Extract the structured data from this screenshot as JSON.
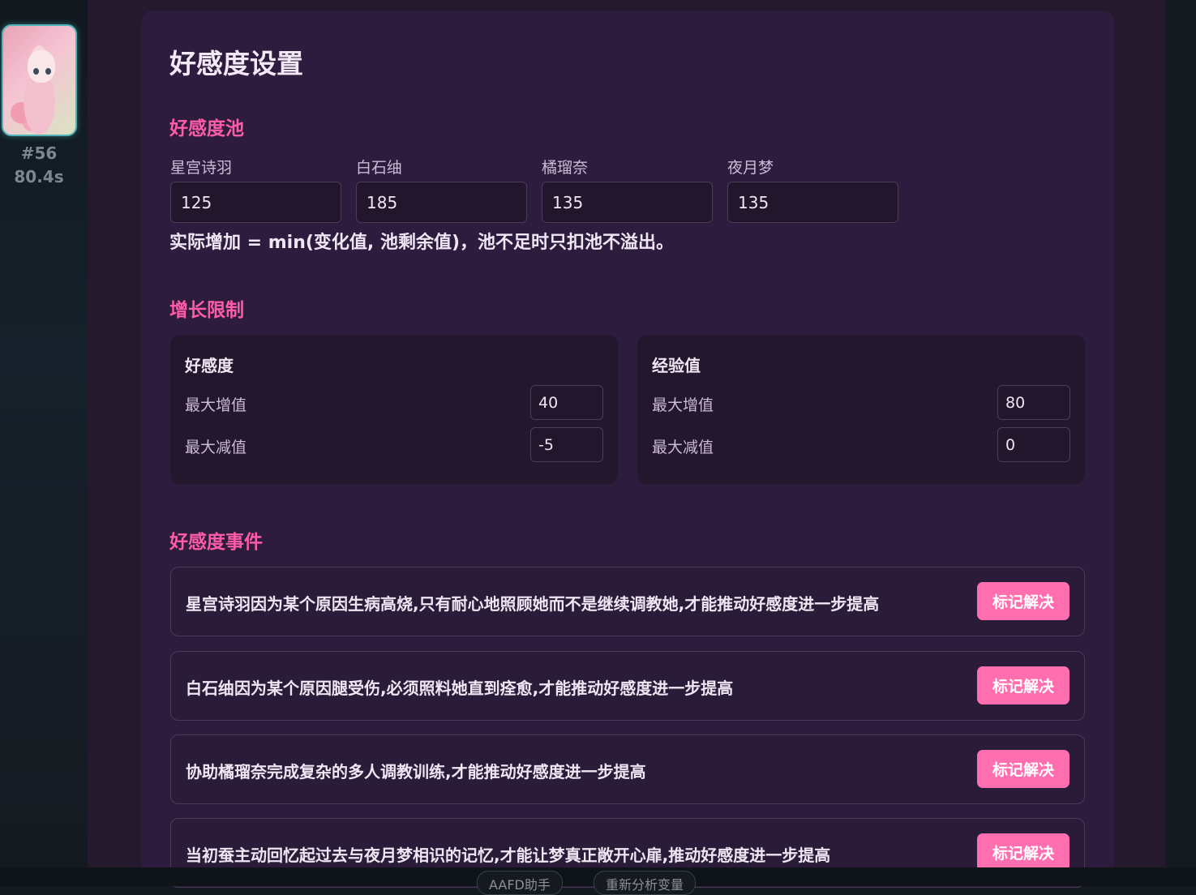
{
  "sidebar": {
    "index": "#56",
    "time": "80.4s"
  },
  "page": {
    "title": "好感度设置"
  },
  "pool": {
    "section_title": "好感度池",
    "characters": [
      {
        "name": "星宫诗羽",
        "value": "125"
      },
      {
        "name": "白石䌷",
        "value": "185"
      },
      {
        "name": "橘瑠奈",
        "value": "135"
      },
      {
        "name": "夜月梦",
        "value": "135"
      }
    ],
    "note": "实际增加 = min(变化值, 池剩余值)，池不足时只扣池不溢出。"
  },
  "limits": {
    "section_title": "增长限制",
    "boxes": [
      {
        "title": "好感度",
        "max_inc_label": "最大增值",
        "max_inc": "40",
        "max_dec_label": "最大减值",
        "max_dec": "-5"
      },
      {
        "title": "经验值",
        "max_inc_label": "最大增值",
        "max_inc": "80",
        "max_dec_label": "最大减值",
        "max_dec": "0"
      }
    ]
  },
  "events": {
    "section_title": "好感度事件",
    "button_label": "标记解决",
    "items": [
      "星宫诗羽因为某个原因生病高烧,只有耐心地照顾她而不是继续调教她,才能推动好感度进一步提高",
      "白石䌷因为某个原因腿受伤,必须照料她直到痊愈,才能推动好感度进一步提高",
      "协助橘瑠奈完成复杂的多人调教训练,才能推动好感度进一步提高",
      "当初蚕主动回忆起过去与夜月梦相识的记忆,才能让梦真正敞开心扉,推动好感度进一步提高"
    ]
  },
  "footer": {
    "chip1": "AAFD助手",
    "chip2": "重新分析变量"
  }
}
